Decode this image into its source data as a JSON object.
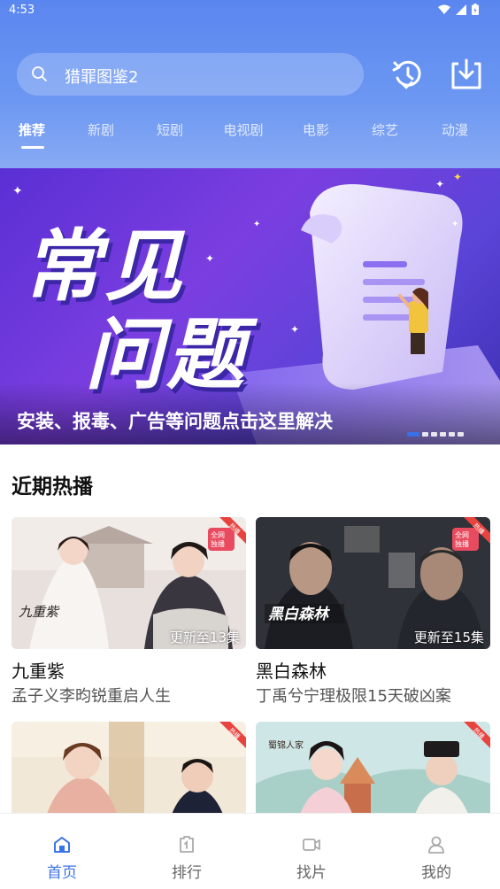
{
  "status": {
    "time": "4:53"
  },
  "search": {
    "text": "猎罪图鉴2"
  },
  "tabs": [
    {
      "label": "推荐",
      "active": true
    },
    {
      "label": "新剧"
    },
    {
      "label": "短剧"
    },
    {
      "label": "电视剧"
    },
    {
      "label": "电影"
    },
    {
      "label": "综艺"
    },
    {
      "label": "动漫"
    }
  ],
  "banner": {
    "headline_1": "常见",
    "headline_2": "问题",
    "caption": "安装、报毒、广告等问题点击这里解决",
    "slide_count": 6,
    "active_slide": 1
  },
  "section": {
    "title": "近期热播"
  },
  "cards": [
    {
      "title": "九重紫",
      "subtitle": "孟子义李昀锐重启人生",
      "update": "更新至13集",
      "badge": "热播",
      "poster_tag": "全网独播"
    },
    {
      "title": "黑白森林",
      "subtitle": "丁禹兮宁理极限15天破凶案",
      "update": "更新至15集",
      "badge": "热播",
      "poster_tag": "全网独播"
    },
    {
      "title": "",
      "subtitle": "",
      "update": "",
      "badge": "热播"
    },
    {
      "title": "",
      "subtitle": "",
      "update": "",
      "badge": "热播"
    }
  ],
  "bottom_nav": [
    {
      "label": "首页",
      "icon": "home-icon",
      "active": true
    },
    {
      "label": "排行",
      "icon": "ranking-icon"
    },
    {
      "label": "找片",
      "icon": "video-icon"
    },
    {
      "label": "我的",
      "icon": "user-icon"
    }
  ],
  "colors": {
    "accent": "#3c73e6",
    "header": "#5a86ef",
    "hot": "#e8433f"
  }
}
